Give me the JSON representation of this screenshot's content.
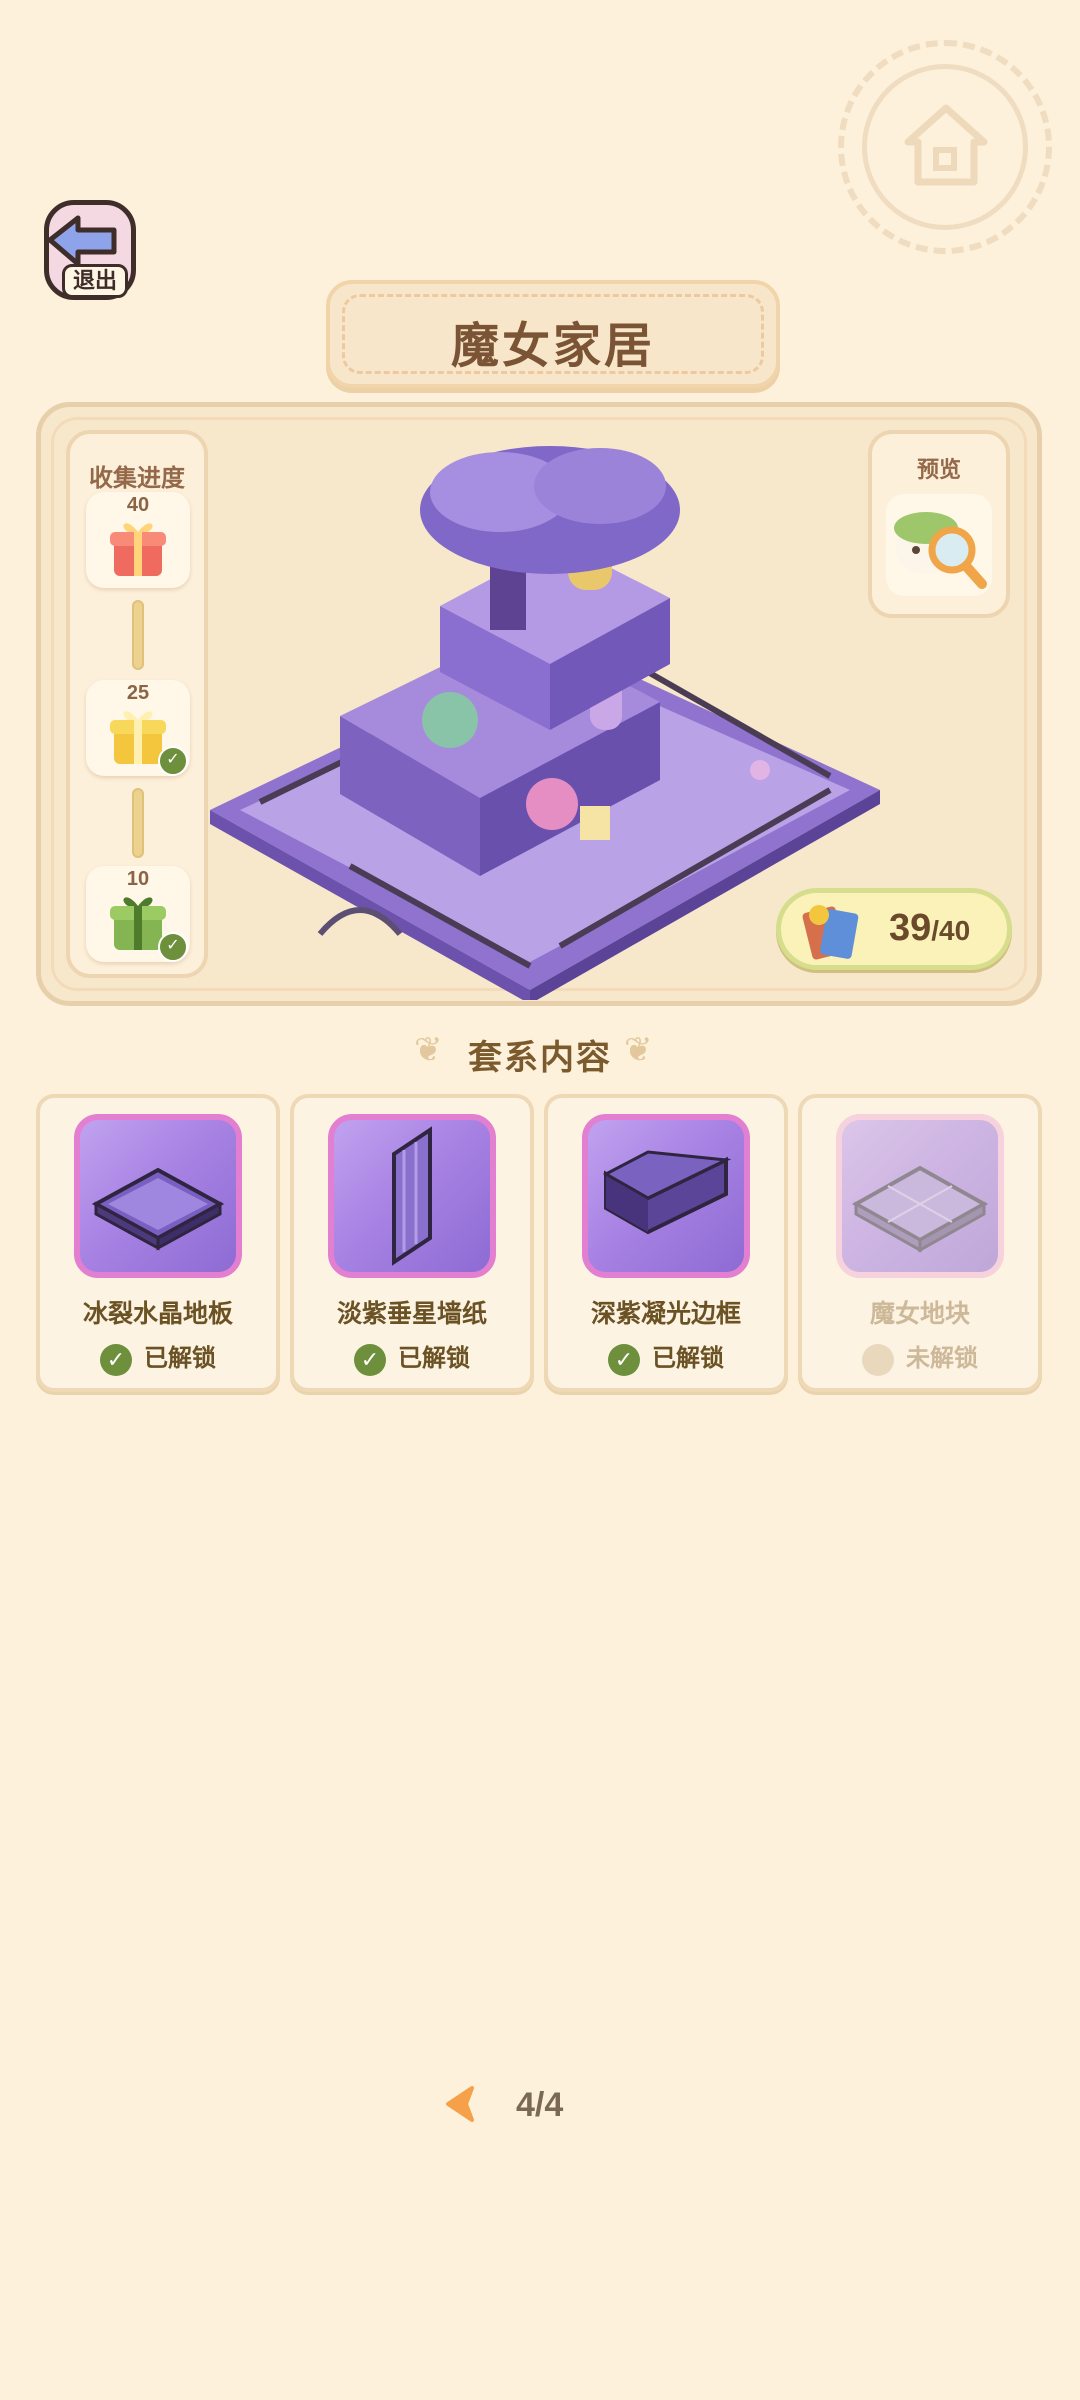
{
  "header": {
    "exit_label": "退出",
    "title": "魔女家居"
  },
  "progress": {
    "title": "收集进度",
    "rewards": [
      {
        "threshold": "40",
        "icon": "red-gift-box-icon",
        "claimed": false
      },
      {
        "threshold": "25",
        "icon": "gold-gift-box-icon",
        "claimed": true
      },
      {
        "threshold": "10",
        "icon": "green-gift-box-icon",
        "claimed": true
      }
    ]
  },
  "preview": {
    "title": "预览"
  },
  "collection": {
    "current": "39",
    "total": "/40",
    "icon": "collection-book-icon"
  },
  "section": {
    "title": "套系内容"
  },
  "items": [
    {
      "name": "冰裂水晶地板",
      "status": "已解锁",
      "unlocked": true,
      "icon": "crystal-floor-icon"
    },
    {
      "name": "淡紫垂星墙纸",
      "status": "已解锁",
      "unlocked": true,
      "icon": "wallpaper-icon"
    },
    {
      "name": "深紫凝光边框",
      "status": "已解锁",
      "unlocked": true,
      "icon": "border-frame-icon"
    },
    {
      "name": "魔女地块",
      "status": "未解锁",
      "unlocked": false,
      "icon": "ground-tile-icon"
    }
  ],
  "pager": {
    "label": "4/4"
  },
  "colors": {
    "background": "#fdf1db",
    "accent_purple": "#8d6bd3",
    "unlocked_green": "#6e8f3c",
    "pager_arrow": "#f6a04a"
  }
}
